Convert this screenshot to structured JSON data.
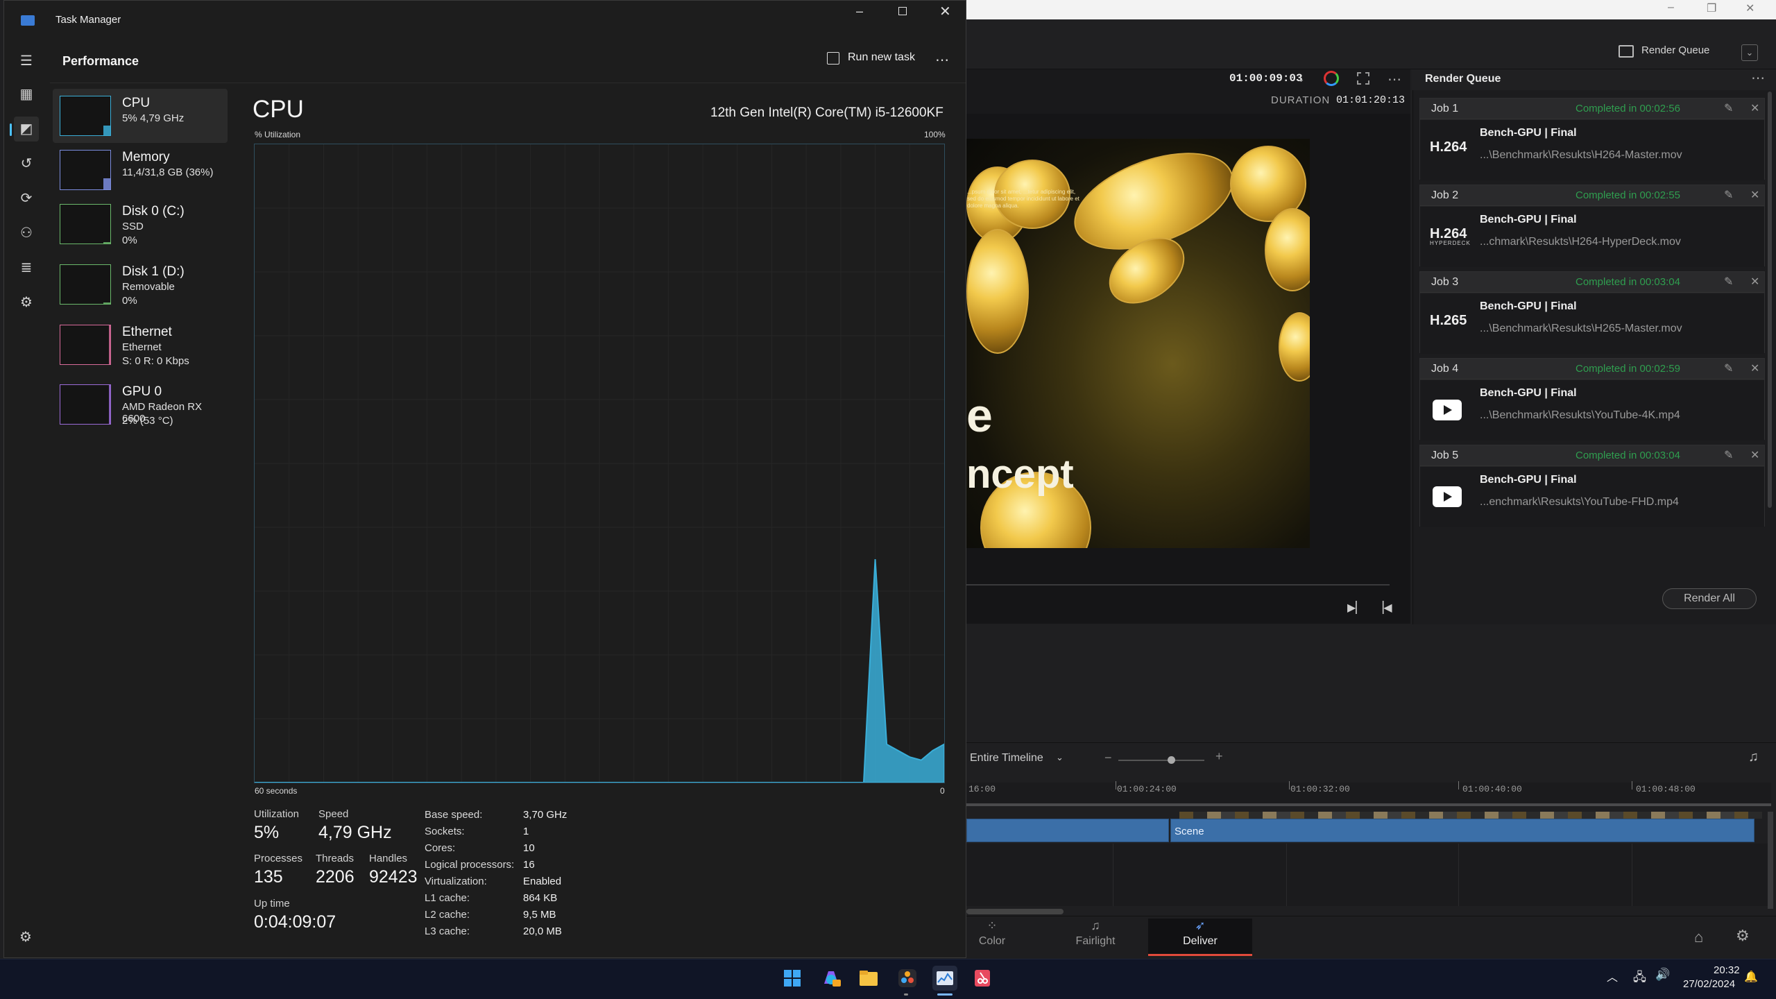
{
  "taskmanager": {
    "window_title": "Task Manager",
    "header": {
      "title": "Performance",
      "run_new_task": "Run new task",
      "more": "⋯"
    },
    "window_controls": {
      "minimize": "–",
      "close": "✕"
    },
    "nav_icons": [
      "hamburger-menu-icon",
      "processes-icon",
      "performance-icon",
      "app-history-icon",
      "startup-apps-icon",
      "users-icon",
      "details-icon",
      "services-icon"
    ],
    "sidebar": [
      {
        "name": "CPU",
        "line2": "5% 4,79 GHz",
        "line3": "",
        "color": "#3aaed8",
        "selected": true
      },
      {
        "name": "Memory",
        "line2": "11,4/31,8 GB (36%)",
        "line3": "",
        "color": "#7b8cde",
        "selected": false
      },
      {
        "name": "Disk 0 (C:)",
        "line2": "SSD",
        "line3": "0%",
        "color": "#6bb86b",
        "selected": false
      },
      {
        "name": "Disk 1 (D:)",
        "line2": "Removable",
        "line3": "0%",
        "color": "#6bb86b",
        "selected": false
      },
      {
        "name": "Ethernet",
        "line2": "Ethernet",
        "line3": "S: 0 R: 0 Kbps",
        "color": "#d86b9a",
        "selected": false
      },
      {
        "name": "GPU 0",
        "line2": "AMD Radeon RX 6600",
        "line3": "2% (53 °C)",
        "color": "#9b6bd8",
        "selected": false
      }
    ],
    "cpu": {
      "title": "CPU",
      "model": "12th Gen Intel(R) Core(TM) i5-12600KF",
      "graph_label": "% Utilization",
      "graph_max_label": "100%",
      "x_left_label": "60 seconds",
      "x_right_label": "0",
      "stats": {
        "utilization_label": "Utilization",
        "utilization": "5%",
        "speed_label": "Speed",
        "speed": "4,79 GHz",
        "processes_label": "Processes",
        "processes": "135",
        "threads_label": "Threads",
        "threads": "2206",
        "handles_label": "Handles",
        "handles": "92423",
        "uptime_label": "Up time",
        "uptime": "0:04:09:07"
      },
      "specs": [
        {
          "k": "Base speed:",
          "v": "3,70 GHz"
        },
        {
          "k": "Sockets:",
          "v": "1"
        },
        {
          "k": "Cores:",
          "v": "10"
        },
        {
          "k": "Logical processors:",
          "v": "16"
        },
        {
          "k": "Virtualization:",
          "v": "Enabled"
        },
        {
          "k": "L1 cache:",
          "v": "864 KB"
        },
        {
          "k": "L2 cache:",
          "v": "9,5 MB"
        },
        {
          "k": "L3 cache:",
          "v": "20,0 MB"
        }
      ]
    }
  },
  "chart_data": {
    "type": "area",
    "title": "CPU",
    "ylabel": "% Utilization",
    "xlabel": "60 seconds",
    "x_range": [
      60,
      0
    ],
    "ylim": [
      0,
      100
    ],
    "grid": true,
    "color": "#3aaed8",
    "series": [
      {
        "x": [
          60,
          52,
          51,
          50,
          49,
          48,
          47,
          46,
          45,
          44,
          43,
          42,
          41,
          40,
          39,
          38,
          37,
          36,
          35,
          34,
          33,
          32,
          31,
          30,
          29,
          28,
          27,
          26,
          25,
          24,
          23,
          22,
          21,
          20,
          19,
          18,
          17,
          16,
          15,
          14,
          13,
          12,
          11,
          10,
          9,
          8,
          7,
          6,
          5,
          4,
          3,
          2,
          1,
          0
        ],
        "values": [
          0,
          0,
          0,
          0,
          0,
          0,
          0,
          0,
          0,
          0,
          0,
          0,
          0,
          0,
          0,
          0,
          0,
          0,
          0,
          0,
          0,
          0,
          0,
          0,
          0,
          0,
          0,
          0,
          0,
          0,
          0,
          0,
          0,
          0,
          0,
          0,
          0,
          0,
          0,
          0,
          0,
          0,
          0,
          0,
          0,
          0,
          0,
          35,
          6,
          5,
          4,
          3.5,
          5,
          6
        ]
      }
    ]
  },
  "resolve": {
    "render_queue_button": "Render Queue",
    "timecode": "01:00:09:03",
    "duration_label": "DURATION",
    "duration": "01:01:20:13",
    "queue_title": "Render Queue",
    "render_all": "Render All",
    "video_overlay_text": "...psum dolor sit amet, ...tetur adipiscing elit, sed do eiusmod tempor incididunt ut labore et dolore magna aliqua.",
    "video_big_1": "e",
    "video_big_2": "ncept",
    "jobs": [
      {
        "name": "Job 1",
        "status": "Completed in 00:02:56",
        "format": "H.264",
        "format_sub": "",
        "icon": "h264",
        "title": "Bench-GPU | Final",
        "path": "...\\Benchmark\\Resukts\\H264-Master.mov"
      },
      {
        "name": "Job 2",
        "status": "Completed in 00:02:55",
        "format": "H.264",
        "format_sub": "HYPERDECK",
        "icon": "h264",
        "title": "Bench-GPU | Final",
        "path": "...chmark\\Resukts\\H264-HyperDeck.mov"
      },
      {
        "name": "Job 3",
        "status": "Completed in 00:03:04",
        "format": "H.265",
        "format_sub": "",
        "icon": "h265",
        "title": "Bench-GPU | Final",
        "path": "...\\Benchmark\\Resukts\\H265-Master.mov"
      },
      {
        "name": "Job 4",
        "status": "Completed in 00:02:59",
        "format": "",
        "format_sub": "",
        "icon": "youtube",
        "title": "Bench-GPU | Final",
        "path": "...\\Benchmark\\Resukts\\YouTube-4K.mp4"
      },
      {
        "name": "Job 5",
        "status": "Completed in 00:03:04",
        "format": "",
        "format_sub": "",
        "icon": "youtube",
        "title": "Bench-GPU | Final",
        "path": "...enchmark\\Resukts\\YouTube-FHD.mp4"
      }
    ],
    "timeline": {
      "range": "Entire Timeline",
      "ticks": [
        "16:00",
        "01:00:24:00",
        "01:00:32:00",
        "01:00:40:00",
        "01:00:48:00"
      ],
      "clip_label": "Scene"
    },
    "pages": [
      {
        "label": "Color",
        "icon": "color-page-icon",
        "active": false
      },
      {
        "label": "Fairlight",
        "icon": "fairlight-page-icon",
        "active": false
      },
      {
        "label": "Deliver",
        "icon": "deliver-page-icon",
        "active": true
      }
    ]
  },
  "taskbar": {
    "apps": [
      "start-icon",
      "copilot-icon",
      "file-explorer-icon",
      "davinci-resolve-icon",
      "task-manager-icon",
      "snipping-tool-icon"
    ],
    "clock_time": "20:32",
    "clock_date": "27/02/2024"
  }
}
